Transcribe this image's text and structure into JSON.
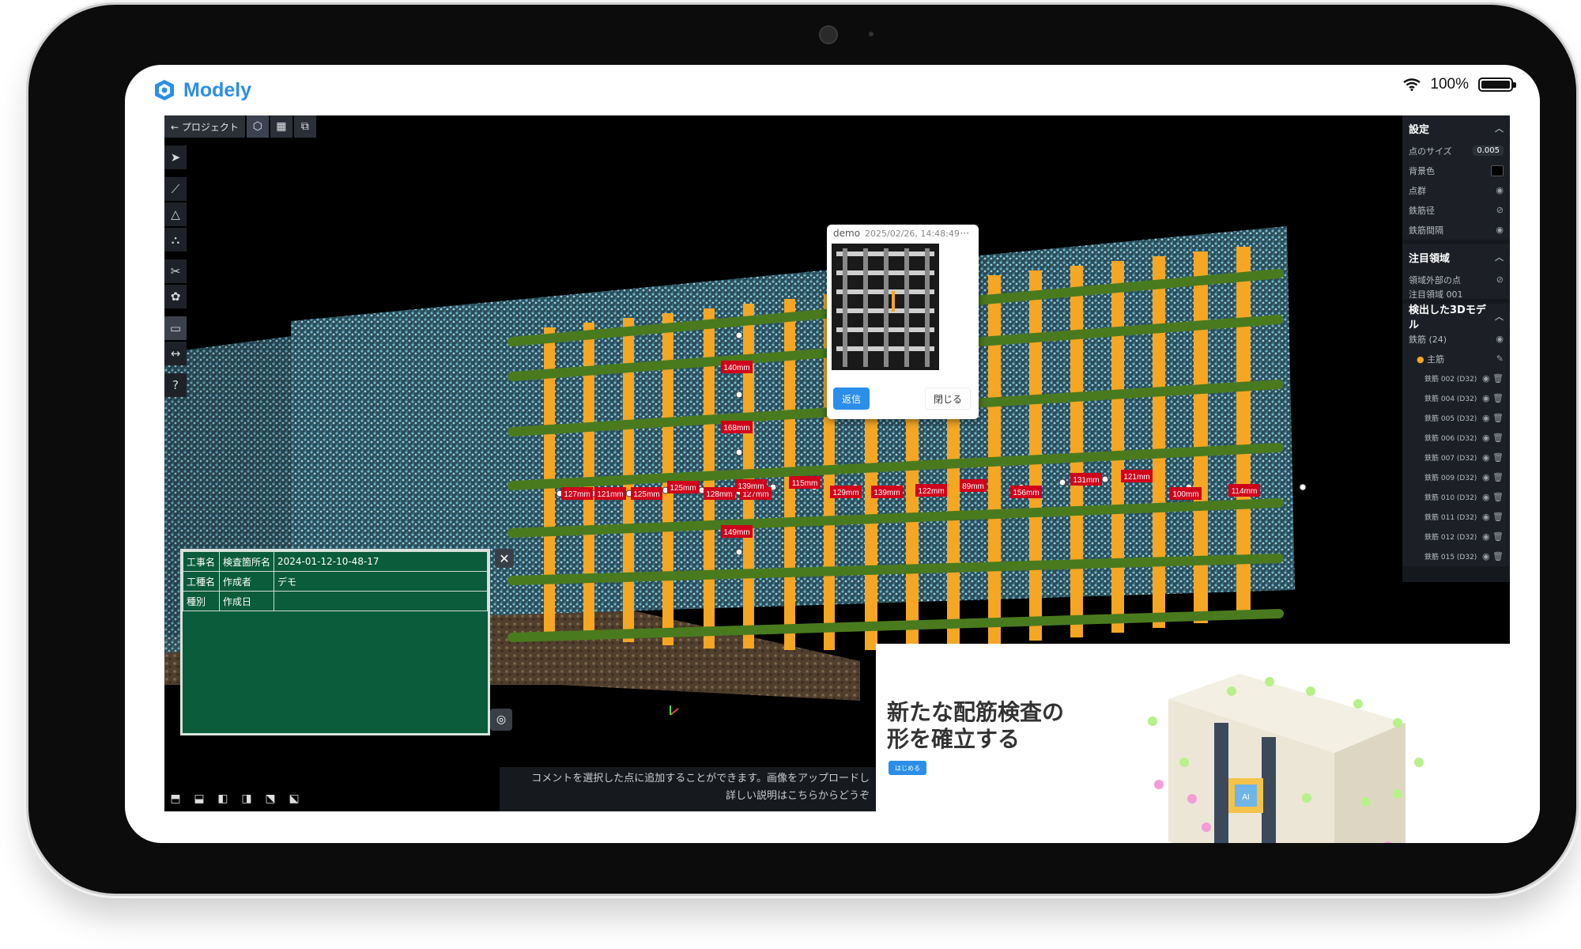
{
  "app": {
    "name": "Modely"
  },
  "status": {
    "battery": "100%"
  },
  "topbar": {
    "back_label": "← プロジェクト"
  },
  "settings": {
    "title": "設定",
    "point_size_label": "点のサイズ",
    "point_size_value": "0.005",
    "bg_color_label": "背景色",
    "point_cloud_label": "点群",
    "rebar_diameter_label": "鉄筋径",
    "rebar_spacing_label": "鉄筋間隔"
  },
  "roi": {
    "title": "注目領域",
    "outside_points_label": "領域外部の点",
    "roi_item": "注目領域 001"
  },
  "models": {
    "title": "検出した3Dモデル",
    "group_label": "鉄筋 (24)",
    "subgroup_label": "主筋",
    "items": [
      {
        "label": "鉄筋 002 (D32)"
      },
      {
        "label": "鉄筋 004 (D32)"
      },
      {
        "label": "鉄筋 005 (D32)"
      },
      {
        "label": "鉄筋 006 (D32)"
      },
      {
        "label": "鉄筋 007 (D32)"
      },
      {
        "label": "鉄筋 009 (D32)"
      },
      {
        "label": "鉄筋 010 (D32)"
      },
      {
        "label": "鉄筋 011 (D32)"
      },
      {
        "label": "鉄筋 012 (D32)"
      },
      {
        "label": "鉄筋 015 (D32)"
      }
    ]
  },
  "comment": {
    "user": "demo",
    "timestamp": "2025/02/26, 14:48:49",
    "more": "···",
    "reply_label": "返信",
    "close_label": "閉じる"
  },
  "measurements": {
    "vertical": [
      "140mm",
      "168mm",
      "149mm"
    ],
    "horizontal": [
      "127mm",
      "121mm",
      "125mm",
      "125mm",
      "128mm",
      "127mm",
      "139mm",
      "115mm",
      "129mm",
      "139mm",
      "122mm",
      "89mm",
      "156mm",
      "131mm",
      "121mm",
      "100mm",
      "114mm"
    ]
  },
  "blackboard": {
    "rows": [
      [
        "工事名",
        "検査箇所名",
        "2024-01-12-10-48-17"
      ],
      [
        "工種名",
        "作成者",
        "デモ"
      ],
      [
        "種別",
        "作成日",
        ""
      ]
    ],
    "close": "✕"
  },
  "hint": {
    "line1": "コメントを選択した点に追加することができます。画像をアップロードし",
    "line2": "詳しい説明はこちらからどうぞ"
  },
  "promo": {
    "title_line1": "新たな配筋検査の",
    "title_line2": "形を確立する",
    "button": "はじめる",
    "model_text": "AI"
  },
  "colors": {
    "accent": "#2b8ee8",
    "rebar_vertical": "#f5a623",
    "rebar_horizontal": "#4a7a1e",
    "label_bg": "#d0021b",
    "board": "#0a5c3a"
  }
}
